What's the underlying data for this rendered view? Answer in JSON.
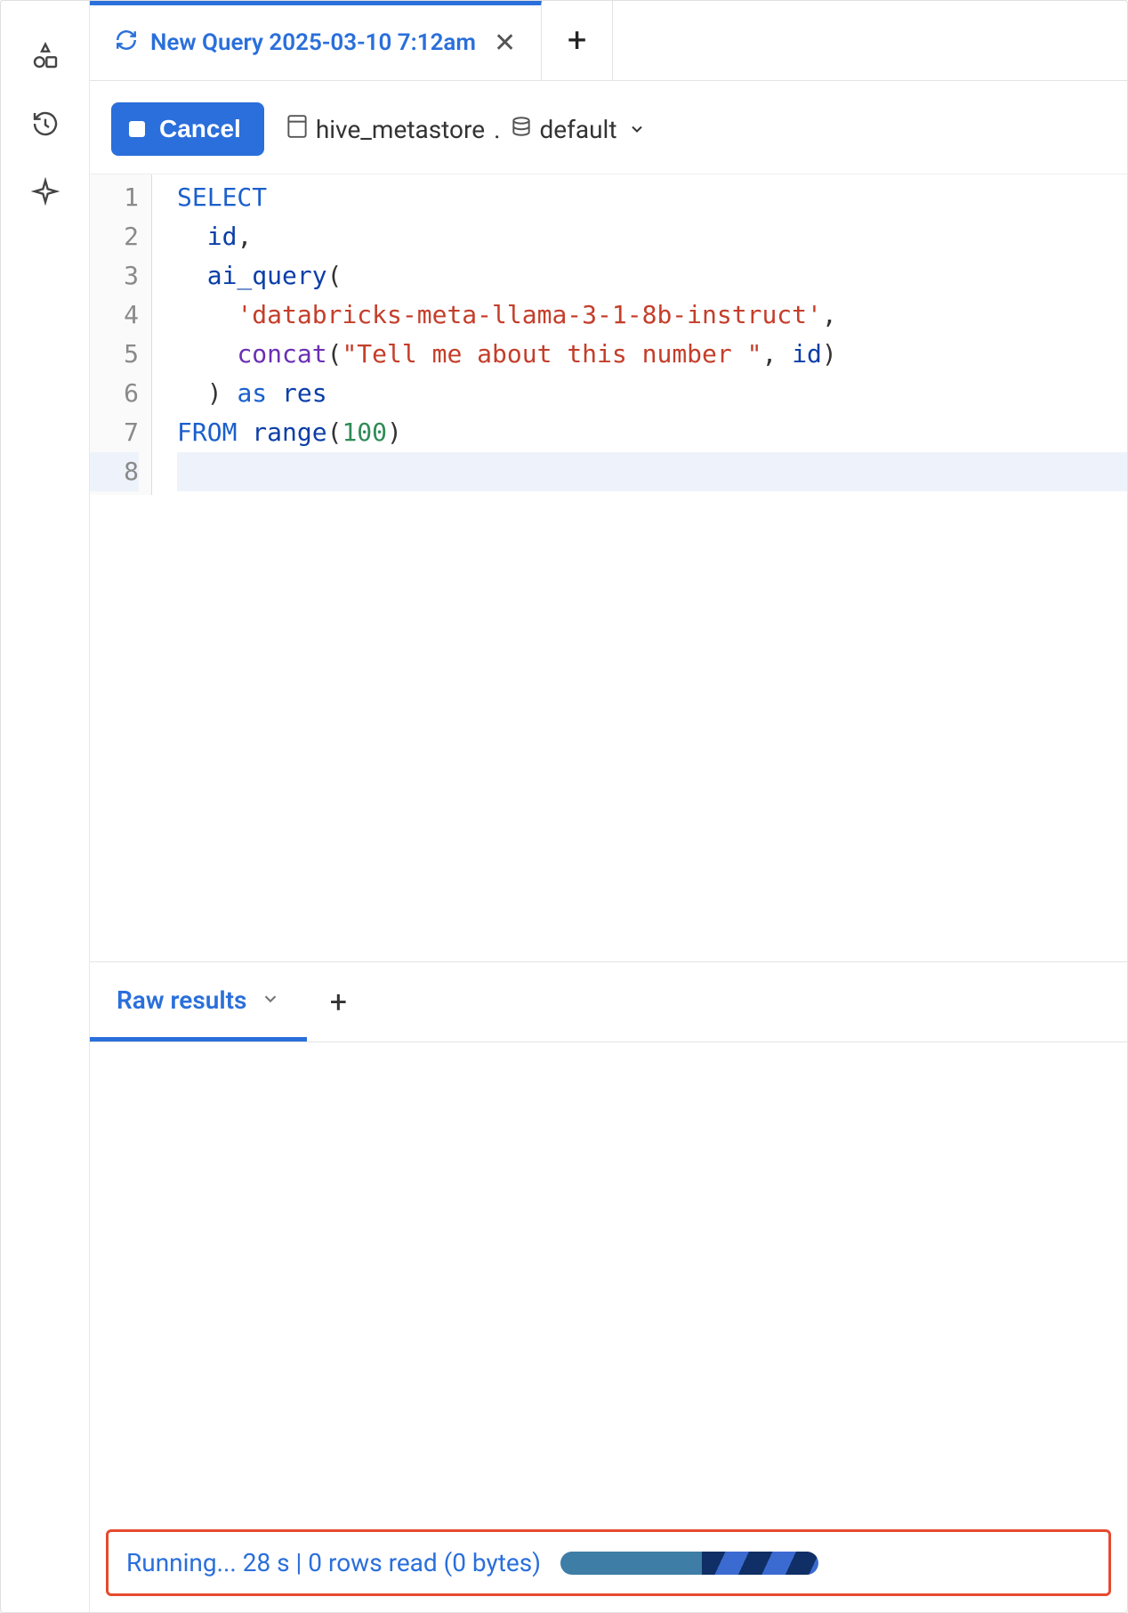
{
  "sidebar": {
    "icons": [
      "shapes-icon",
      "history-icon",
      "sparkle-icon"
    ]
  },
  "tab": {
    "title": "New Query 2025-03-10 7:12am"
  },
  "toolbar": {
    "cancel_label": "Cancel",
    "catalog": "hive_metastore",
    "schema": "default"
  },
  "editor": {
    "line_numbers": [
      "1",
      "2",
      "3",
      "4",
      "5",
      "6",
      "7",
      "8"
    ],
    "lines": [
      [
        {
          "t": "SELECT",
          "c": "kw"
        }
      ],
      [
        {
          "t": "  id",
          "c": "ident"
        },
        {
          "t": ",",
          "c": "punct"
        }
      ],
      [
        {
          "t": "  ai_query",
          "c": "ident"
        },
        {
          "t": "(",
          "c": "punct"
        }
      ],
      [
        {
          "t": "    ",
          "c": "punct"
        },
        {
          "t": "'databricks-meta-llama-3-1-8b-instruct'",
          "c": "str"
        },
        {
          "t": ",",
          "c": "punct"
        }
      ],
      [
        {
          "t": "    ",
          "c": "punct"
        },
        {
          "t": "concat",
          "c": "func"
        },
        {
          "t": "(",
          "c": "punct"
        },
        {
          "t": "\"Tell me about this number \"",
          "c": "str"
        },
        {
          "t": ", ",
          "c": "punct"
        },
        {
          "t": "id",
          "c": "ident"
        },
        {
          "t": ")",
          "c": "punct"
        }
      ],
      [
        {
          "t": "  ) ",
          "c": "punct"
        },
        {
          "t": "as",
          "c": "kw"
        },
        {
          "t": " res",
          "c": "ident"
        }
      ],
      [
        {
          "t": "FROM",
          "c": "kw"
        },
        {
          "t": " ",
          "c": "punct"
        },
        {
          "t": "range",
          "c": "ident"
        },
        {
          "t": "(",
          "c": "punct"
        },
        {
          "t": "100",
          "c": "num"
        },
        {
          "t": ")",
          "c": "punct"
        }
      ],
      [
        {
          "t": "",
          "c": "punct"
        }
      ]
    ],
    "active_line_index": 7
  },
  "results": {
    "tab_label": "Raw results",
    "status": "Running... 28 s | 0 rows read (0 bytes)"
  }
}
